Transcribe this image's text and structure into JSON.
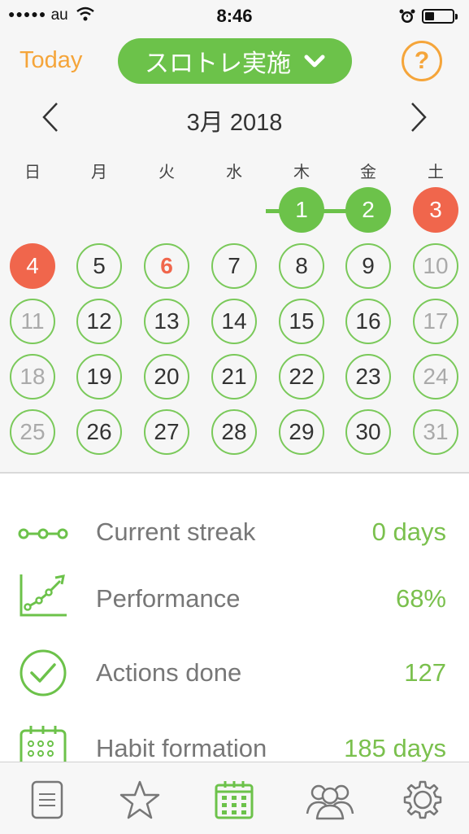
{
  "status_bar": {
    "signal": "●●●●●",
    "carrier": "au",
    "time": "8:46"
  },
  "header": {
    "today_label": "Today",
    "mode_label": "スロトレ実施",
    "help_label": "?"
  },
  "calendar": {
    "month_label": "3月 2018",
    "weekdays": [
      "日",
      "月",
      "火",
      "水",
      "木",
      "金",
      "土"
    ],
    "days": [
      "1",
      "2",
      "3",
      "4",
      "5",
      "6",
      "7",
      "8",
      "9",
      "10",
      "11",
      "12",
      "13",
      "14",
      "15",
      "16",
      "17",
      "18",
      "19",
      "20",
      "21",
      "22",
      "23",
      "24",
      "25",
      "26",
      "27",
      "28",
      "29",
      "30",
      "31"
    ],
    "done_days": [
      1,
      2
    ],
    "missed_days": [
      3,
      4
    ],
    "today": 6
  },
  "stats": [
    {
      "label": "Current streak",
      "value": "0 days",
      "icon": "streak-icon"
    },
    {
      "label": "Performance",
      "value": "68%",
      "icon": "performance-chart-icon"
    },
    {
      "label": "Actions done",
      "value": "127",
      "icon": "checkmark-circle-icon"
    },
    {
      "label": "Habit formation",
      "value": "185 days",
      "icon": "calendar-grid-icon"
    }
  ],
  "tabbar": {
    "tabs": [
      "list-icon",
      "star-icon",
      "calendar-icon",
      "group-icon",
      "gear-icon"
    ],
    "active_tab": "calendar-icon"
  },
  "colors": {
    "accent_green": "#6cc24a",
    "accent_orange": "#f5a53a",
    "missed_red": "#f0664c",
    "stat_value_green": "#7ac04d"
  }
}
